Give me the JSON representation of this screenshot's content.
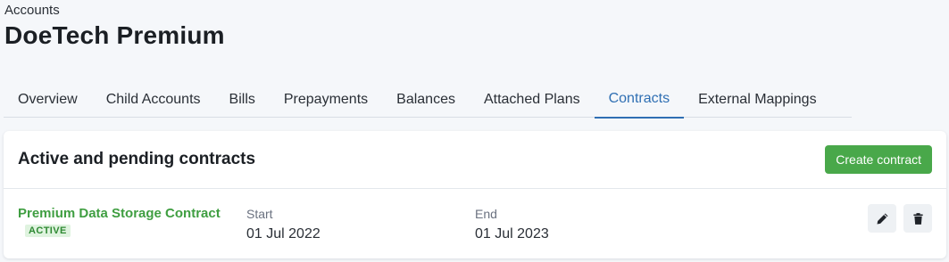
{
  "breadcrumb": "Accounts",
  "page_title": "DoeTech Premium",
  "tabs": [
    {
      "label": "Overview",
      "active": false
    },
    {
      "label": "Child Accounts",
      "active": false
    },
    {
      "label": "Bills",
      "active": false
    },
    {
      "label": "Prepayments",
      "active": false
    },
    {
      "label": "Balances",
      "active": false
    },
    {
      "label": "Attached Plans",
      "active": false
    },
    {
      "label": "Contracts",
      "active": true
    },
    {
      "label": "External Mappings",
      "active": false
    }
  ],
  "contracts_section": {
    "title": "Active and pending contracts",
    "create_button_label": "Create contract",
    "contracts": [
      {
        "name": "Premium Data Storage Contract",
        "status": "ACTIVE",
        "start_label": "Start",
        "start_value": "01 Jul 2022",
        "end_label": "End",
        "end_value": "01 Jul 2023",
        "actions": [
          {
            "icon": "pencil-icon"
          },
          {
            "icon": "trash-icon"
          }
        ]
      }
    ]
  },
  "colors": {
    "accent_blue": "#2f6fb3",
    "brand_green": "#49a84a",
    "status_green": "#3f9e41",
    "page_background": "#f5f7fa"
  }
}
